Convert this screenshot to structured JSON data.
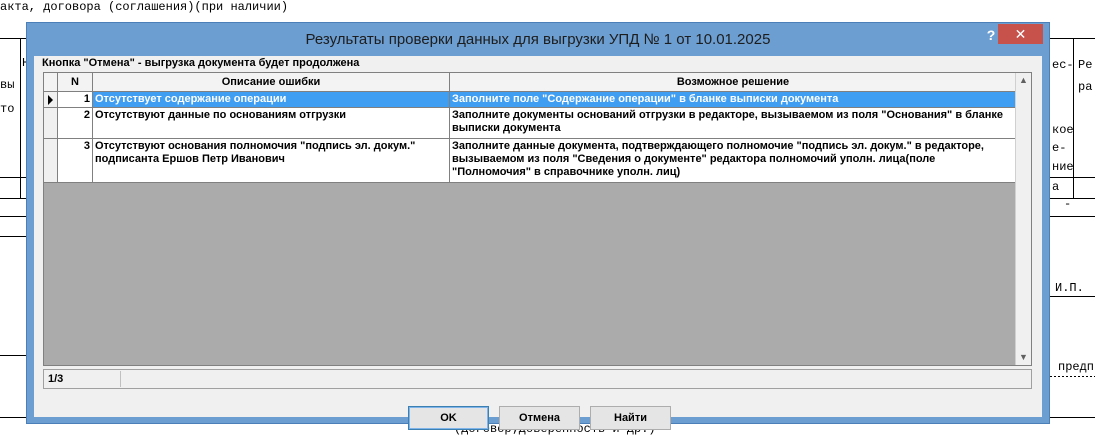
{
  "background": {
    "top_text": "акта, договора (соглашения)(при наличии)",
    "left_col": [
      "Н",
      "вы",
      "то"
    ],
    "right_a": [
      "ес-"
    ],
    "right_b": [
      "Ре",
      "ра"
    ],
    "right_c": [
      "кое",
      "е-",
      "ние"
    ],
    "right_d": [
      "а"
    ],
    "right_e": [
      "-"
    ],
    "right_io": "И.П.",
    "right_pred": "предп",
    "bottom_text": "(договор;доверенность и др.)"
  },
  "dialog": {
    "title": "Результаты проверки данных для выгрузки УПД № 1 от 10.01.2025",
    "help_label": "?",
    "close_label": "✕",
    "hint": "Кнопка \"Отмена\" - выгрузка документа будет продолжена",
    "columns": {
      "n": "N",
      "description": "Описание ошибки",
      "solution": "Возможное решение"
    },
    "rows": [
      {
        "n": "1",
        "description": "Отсутствует содержание операции",
        "solution": "Заполните поле \"Содержание операции\" в бланке выписки документа"
      },
      {
        "n": "2",
        "description": "Отсутствуют данные по основаниям отгрузки",
        "solution": "Заполните документы оснований отгрузки в редакторе, вызываемом из поля \"Основания\" в бланке выписки документа"
      },
      {
        "n": "3",
        "description": "Отсутствуют основания полномочия \"подпись эл. докум.\" подписанта Ершов Петр Иванович",
        "solution": "Заполните данные документа, подтверждающего полномочие \"подпись эл. докум.\" в редакторе, вызываемом из поля \"Сведения о документе\"  редактора полномочий уполн. лица(поле \"Полномочия\" в справочнике уполн. лиц)"
      }
    ],
    "record_counter": "1/3",
    "buttons": {
      "ok": "OK",
      "cancel": "Отмена",
      "find": "Найти"
    }
  }
}
